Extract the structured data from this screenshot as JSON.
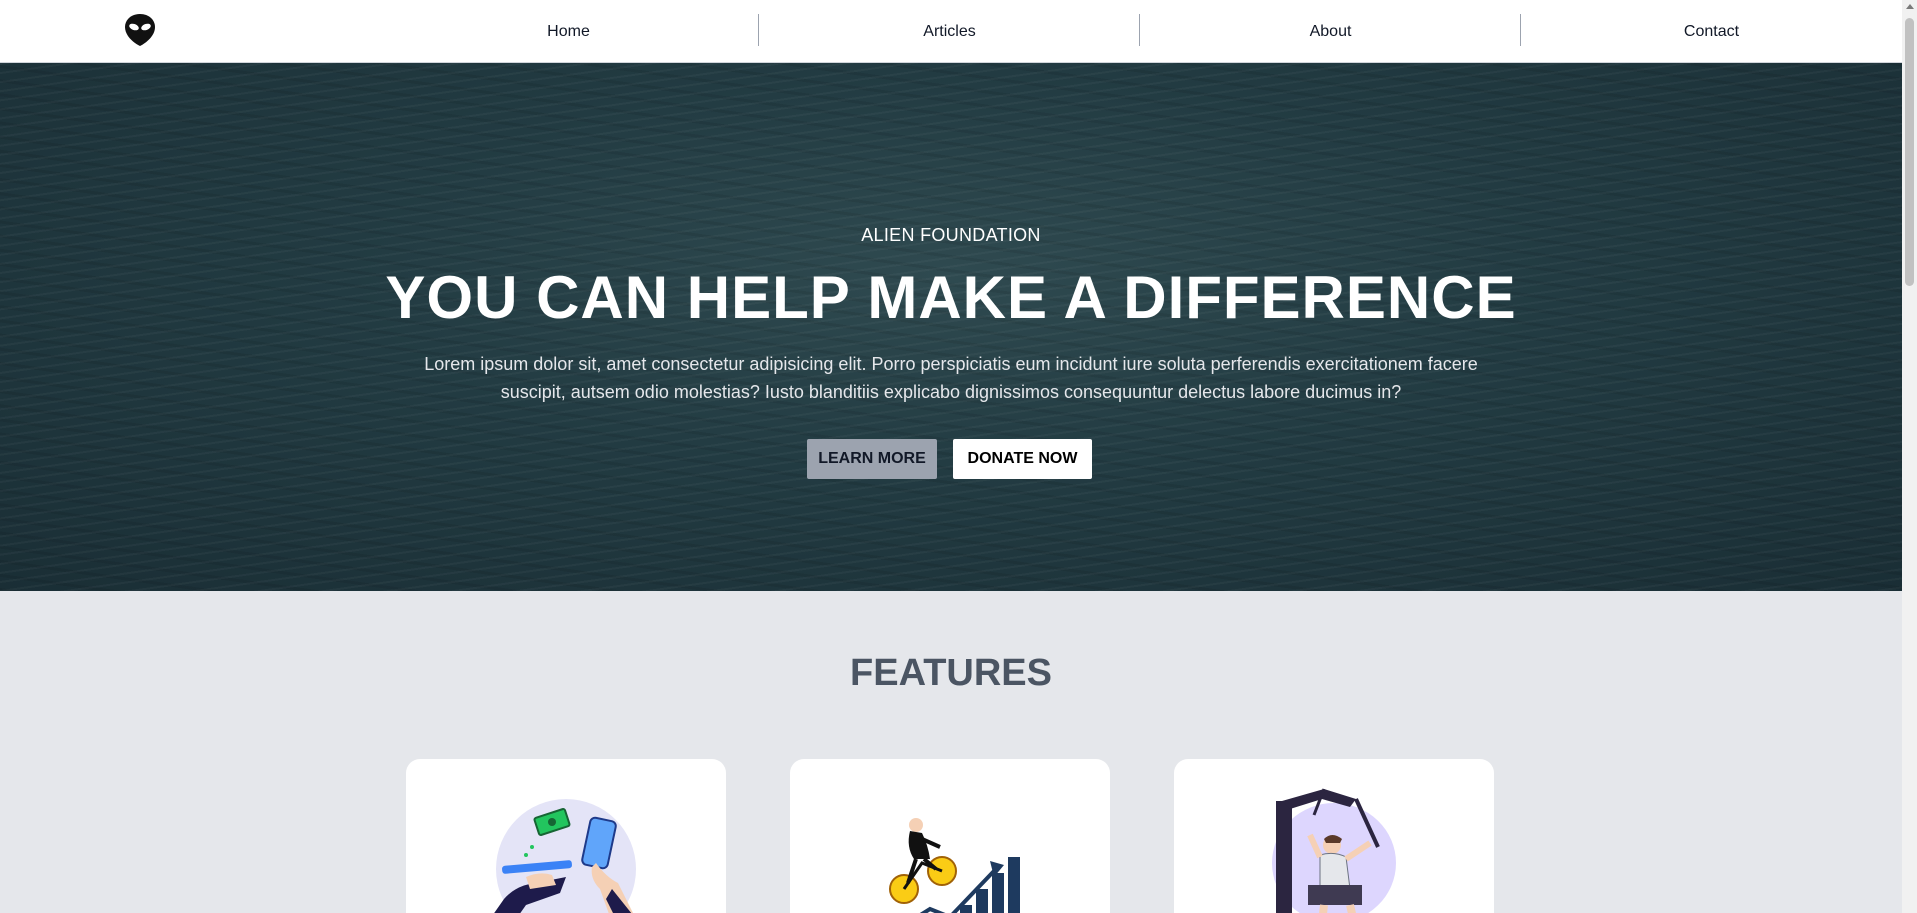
{
  "navbar": {
    "logo_icon": "alien-head-icon",
    "links": [
      "Home",
      "Articles",
      "About",
      "Contact"
    ]
  },
  "hero": {
    "eyebrow": "ALIEN FOUNDATION",
    "title": "YOU CAN HELP MAKE A DIFFERENCE",
    "text": "Lorem ipsum dolor sit, amet consectetur adipisicing elit. Porro perspiciatis eum incidunt iure soluta perferendis exercitationem facere suscipit, autsem odio molestias? Iusto blanditiis explicabo dignissimos consequuntur delectus labore ducimus in?",
    "buttons": {
      "learn_more": "LEARN MORE",
      "donate_now": "DONATE NOW"
    }
  },
  "features": {
    "title": "FEATURES",
    "cards": [
      {
        "icon": "mobile-payment-illustration"
      },
      {
        "icon": "cyclist-growth-chart-illustration"
      },
      {
        "icon": "gym-workout-illustration"
      }
    ]
  },
  "colors": {
    "hero_overlay": "#223b42",
    "learn_button": "#9ca3af",
    "donate_button": "#ffffff",
    "section_background": "#e5e7eb",
    "features_title": "#4b5563"
  }
}
